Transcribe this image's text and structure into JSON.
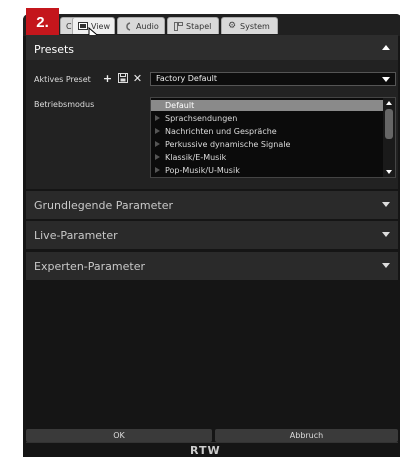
{
  "step_badge": "2.",
  "tabs": [
    {
      "label": "C",
      "icon": "partial-icon"
    },
    {
      "label": "View",
      "icon": "display-icon"
    },
    {
      "label": "Audio",
      "icon": "audio-icon"
    },
    {
      "label": "Stapel",
      "icon": "stack-icon"
    },
    {
      "label": "System",
      "icon": "gear-icon"
    }
  ],
  "presets": {
    "title": "Presets",
    "active_label": "Aktives Preset",
    "active_value": "Factory Default",
    "mode_label": "Betriebsmodus",
    "mode_options": [
      "Default",
      "Sprachsendungen",
      "Nachrichten und Gespräche",
      "Perkussive dynamische Signale",
      "Klassik/E-Musik",
      "Pop-Musik/U-Musik"
    ],
    "selected_option": "Default"
  },
  "sections": {
    "basic": "Grundlegende Parameter",
    "live": "Live-Parameter",
    "expert": "Experten-Parameter"
  },
  "buttons": {
    "ok": "OK",
    "cancel": "Abbruch"
  },
  "brand": "RTW",
  "colors": {
    "badge": "#c4161c",
    "background": "#151515",
    "panel": "#222222",
    "selected": "#8a8a8a"
  }
}
